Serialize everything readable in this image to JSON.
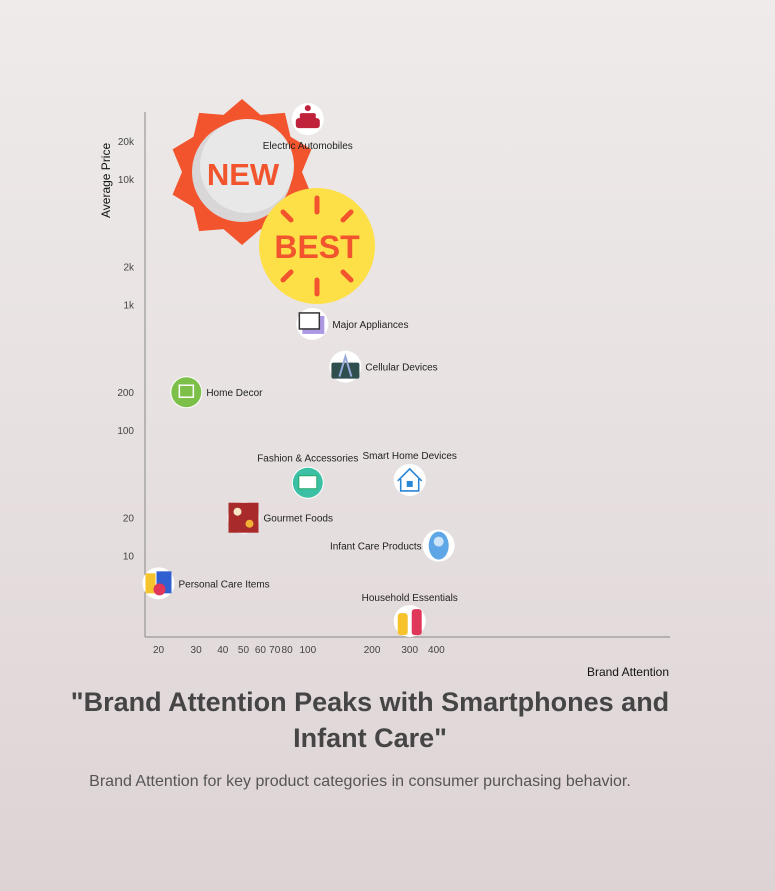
{
  "chart_data": {
    "type": "scatter",
    "title": "\"Brand Attention Peaks with Smartphones and Infant Care\"",
    "subtitle": "Brand Attention for key product categories in consumer purchasing behavior.",
    "xlabel": "Brand Attention",
    "ylabel": "Average Price",
    "x_scale": "log",
    "y_scale": "log",
    "xlim": [
      18,
      470
    ],
    "ylim": [
      2.5,
      60000
    ],
    "x_ticks": [
      20,
      30,
      40,
      50,
      60,
      70,
      80,
      100,
      200,
      300,
      400
    ],
    "y_ticks": [
      10,
      20,
      100,
      200,
      1000,
      2000,
      10000,
      20000
    ],
    "y_tick_labels": [
      "10",
      "20",
      "100",
      "200",
      "1k",
      "2k",
      "10k",
      "20k"
    ],
    "grid": false,
    "points": [
      {
        "label": "Electric Automobiles",
        "x": 100,
        "y": 30000,
        "icon": "electric-car-icon",
        "color": "#c0223b"
      },
      {
        "label": "Major Appliances",
        "x": 105,
        "y": 700,
        "icon": "appliance-icon",
        "color": "#8a6cd6"
      },
      {
        "label": "Cellular Devices",
        "x": 150,
        "y": 320,
        "icon": "cell-tower-icon",
        "color": "#2f4f4f"
      },
      {
        "label": "Home Decor",
        "x": 27,
        "y": 200,
        "icon": "home-decor-icon",
        "color": "#7cc04a"
      },
      {
        "label": "Fashion & Accessories",
        "x": 100,
        "y": 38,
        "icon": "fashion-icon",
        "color": "#3bbfa5"
      },
      {
        "label": "Smart Home Devices",
        "x": 300,
        "y": 40,
        "icon": "smart-home-icon",
        "color": "#2a86d6"
      },
      {
        "label": "Gourmet Foods",
        "x": 50,
        "y": 20,
        "icon": "gourmet-icon",
        "color": "#a92a2a"
      },
      {
        "label": "Infant Care Products",
        "x": 410,
        "y": 12,
        "icon": "infant-icon",
        "color": "#5ea6e6"
      },
      {
        "label": "Personal Care Items",
        "x": 20,
        "y": 6,
        "icon": "personal-care-icon",
        "color": "#f0a020"
      },
      {
        "label": "Household Essentials",
        "x": 300,
        "y": 3,
        "icon": "bottles-icon",
        "color": "#e0365a"
      }
    ],
    "badges": [
      "NEW",
      "BEST"
    ]
  }
}
